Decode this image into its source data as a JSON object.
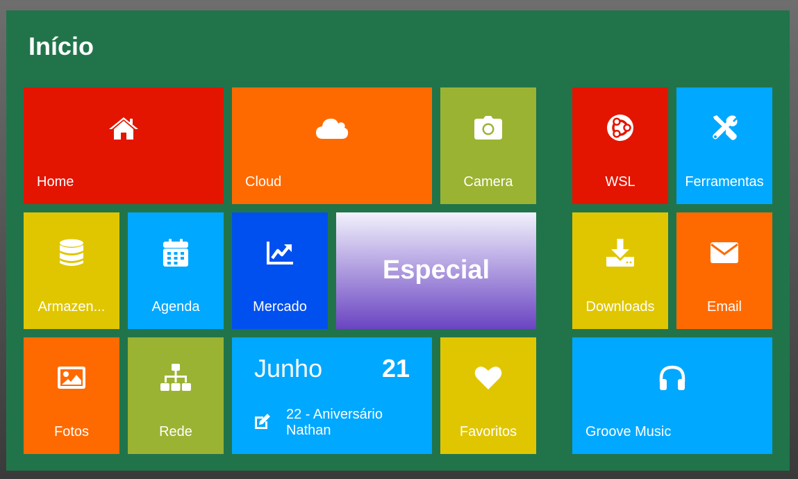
{
  "page": {
    "title": "Início"
  },
  "tiles": {
    "home": {
      "label": "Home",
      "icon": "home-icon",
      "color": "#e31500"
    },
    "cloud": {
      "label": "Cloud",
      "icon": "cloud-icon",
      "color": "#ff6a00"
    },
    "camera": {
      "label": "Camera",
      "icon": "camera-icon",
      "color": "#9bb333"
    },
    "wsl": {
      "label": "WSL",
      "icon": "ubuntu-icon",
      "color": "#e31500"
    },
    "ferramentas": {
      "label": "Ferramentas",
      "icon": "tools-icon",
      "color": "#00a8ff"
    },
    "armazenamento": {
      "label": "Armazen...",
      "icon": "database-icon",
      "color": "#e0c600"
    },
    "agenda": {
      "label": "Agenda",
      "icon": "calendar-icon",
      "color": "#00a8ff"
    },
    "mercado": {
      "label": "Mercado",
      "icon": "chart-line-icon",
      "color": "#0050ef"
    },
    "especial": {
      "label": "Especial",
      "gradient": [
        "#f2f2fc",
        "#6a44c2"
      ]
    },
    "downloads": {
      "label": "Downloads",
      "icon": "download-icon",
      "color": "#e0c600"
    },
    "email": {
      "label": "Email",
      "icon": "envelope-icon",
      "color": "#ff6a00"
    },
    "fotos": {
      "label": "Fotos",
      "icon": "image-icon",
      "color": "#ff6a00"
    },
    "rede": {
      "label": "Rede",
      "icon": "network-icon",
      "color": "#9bb333"
    },
    "calendario": {
      "month": "Junho",
      "day": "21",
      "event_line1": "22 - Aniversário",
      "event_line2": "Nathan",
      "icon": "edit-icon",
      "color": "#00a8ff"
    },
    "favoritos": {
      "label": "Favoritos",
      "icon": "heart-icon",
      "color": "#e0c600"
    },
    "groove": {
      "label": "Groove Music",
      "icon": "headphones-icon",
      "color": "#00a8ff"
    }
  },
  "colors": {
    "background_panel": "#21744a"
  }
}
